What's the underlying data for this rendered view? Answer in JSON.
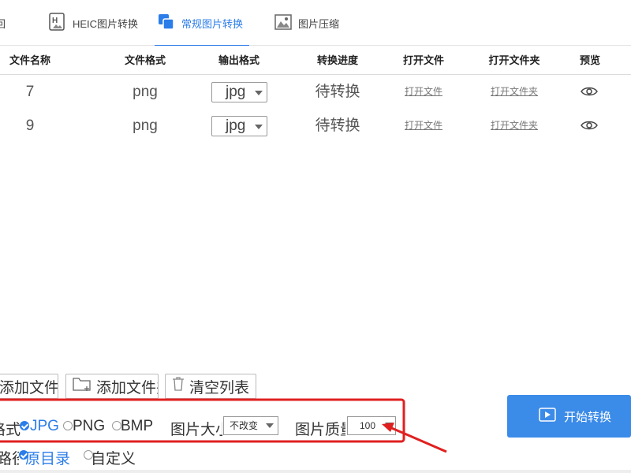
{
  "tabs": {
    "back": "回",
    "heic": "HEIC图片转换",
    "normal": "常规图片转换",
    "compress": "图片压缩"
  },
  "table": {
    "headers": [
      "文件名称",
      "文件格式",
      "输出格式",
      "转换进度",
      "打开文件",
      "打开文件夹",
      "预览"
    ],
    "rows": [
      {
        "name": "7",
        "format": "png",
        "output": "jpg",
        "status": "待转换",
        "open_file": "打开文件",
        "open_folder": "打开文件夹"
      },
      {
        "name": "9",
        "format": "png",
        "output": "jpg",
        "status": "待转换",
        "open_file": "打开文件",
        "open_folder": "打开文件夹"
      }
    ]
  },
  "buttons": {
    "add_file": "添加文件",
    "add_folder": "添加文件夹",
    "clear_list": "清空列表",
    "start": "开始转换"
  },
  "options": {
    "format_label": "格式",
    "formats": [
      "JPG",
      "PNG",
      "BMP"
    ],
    "selected_format": "JPG",
    "size_label": "图片大小",
    "size_value": "不改变",
    "quality_label": "图片质量",
    "quality_value": "100",
    "path_label": "路径",
    "paths": [
      "原目录",
      "自定义"
    ],
    "selected_path": "原目录"
  },
  "colors": {
    "accent": "#2b7de9",
    "start_button": "#3b8be8",
    "annotation": "#e02020"
  }
}
